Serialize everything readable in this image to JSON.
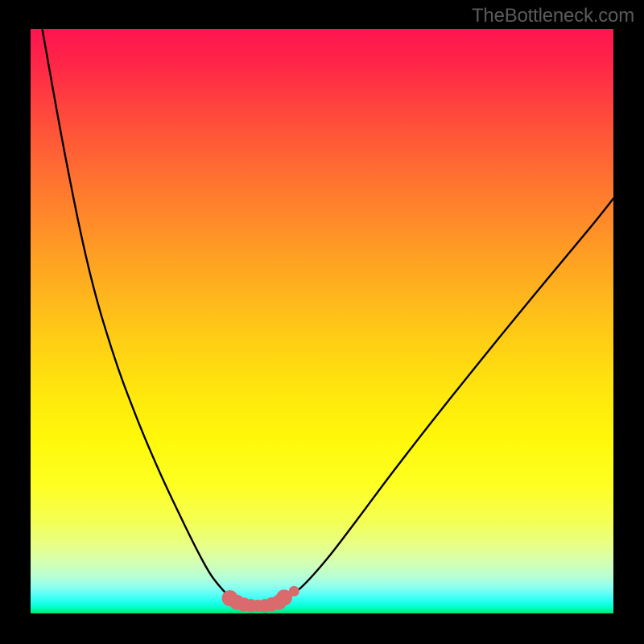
{
  "watermark": "TheBottleneck.com",
  "colors": {
    "frame": "#000000",
    "curve_stroke": "#000000",
    "marker_fill": "#d96b6d",
    "marker_stroke": "#c55a5c"
  },
  "chart_data": {
    "type": "line",
    "title": "",
    "xlabel": "",
    "ylabel": "",
    "xlim": [
      0,
      100
    ],
    "ylim": [
      0,
      100
    ],
    "grid": false,
    "axes_visible": false,
    "note": "Background color encodes the plotted value: red = high (100), green = low (0).",
    "series": [
      {
        "name": "left-branch",
        "x": [
          2,
          6,
          10,
          14,
          18,
          22,
          26,
          29,
          31,
          33,
          34.5,
          35.5
        ],
        "y": [
          100,
          78,
          59,
          45,
          34,
          24.5,
          16,
          10,
          6.5,
          4,
          2.5,
          1.8
        ]
      },
      {
        "name": "right-branch",
        "x": [
          42.5,
          44,
          47,
          51,
          56,
          62,
          69,
          77,
          86,
          96,
          100
        ],
        "y": [
          1.8,
          2.5,
          5,
          9.5,
          16,
          24,
          33,
          43,
          54,
          66,
          71
        ]
      },
      {
        "name": "valley-markers",
        "marker_only": true,
        "x": [
          34.2,
          35.4,
          36.6,
          37.8,
          39.0,
          40.2,
          41.4,
          42.6,
          43.5
        ],
        "y": [
          2.6,
          1.9,
          1.5,
          1.35,
          1.3,
          1.35,
          1.55,
          1.9,
          2.7
        ]
      }
    ]
  }
}
